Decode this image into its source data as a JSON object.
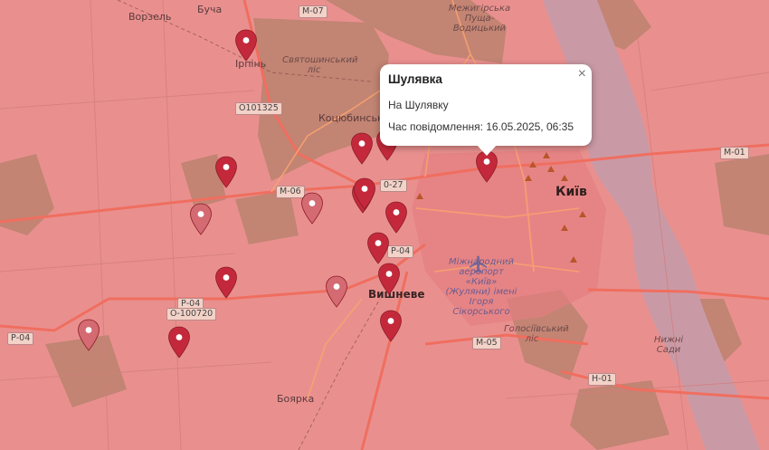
{
  "popup": {
    "title": "Шулявка",
    "description": "На Шулявку",
    "time_label": "Час повідомлення: 16.05.2025, 06:35",
    "close_symbol": "×"
  },
  "places": {
    "vorzel": "Ворзель",
    "bucha": "Буча",
    "irpin": "Ірпінь",
    "sviatoshynskyi_forest": "Святошинський ліс",
    "kotsiubynske": "Коцюбинське",
    "mezhyhirska": "Межигірська Пуща-Водицький",
    "kyiv": "Київ",
    "vyshneve": "Вишневе",
    "airport": "Міжнародний аеропорт «Київ» (Жуляни) імені Ігоря Сікорського",
    "holosiivskyi": "Голосіївський ліс",
    "nyzhni_sady": "Нижні Сади",
    "boiarka": "Боярка"
  },
  "roads": {
    "m07": "М-07",
    "m06": "М-06",
    "m01": "М-01",
    "m05": "М-05",
    "n01": "Н-01",
    "p04_a": "Р-04",
    "p04_b": "Р-04",
    "p04_c": "Р-04",
    "o100720": "О-100720",
    "o101325": "О101325",
    "r27": "0-27"
  },
  "colors": {
    "overlay": "#e9908f",
    "marker": "#c4293b",
    "marker_faded": "#d46a72",
    "water": "#c99aa6",
    "forest": "#b5806a"
  },
  "markers": [
    {
      "name": "marker-irpin",
      "faded": false
    },
    {
      "name": "marker-kotsiubynske",
      "faded": false
    },
    {
      "name": "marker-kotsiubynske-2",
      "faded": false
    },
    {
      "name": "marker-shuliavka",
      "faded": false
    },
    {
      "name": "marker-west-1",
      "faded": false
    },
    {
      "name": "marker-west-2",
      "faded": true
    },
    {
      "name": "marker-center-1",
      "faded": true
    },
    {
      "name": "marker-center-2",
      "faded": false
    },
    {
      "name": "marker-center-3",
      "faded": false
    },
    {
      "name": "marker-center-4",
      "faded": false
    },
    {
      "name": "marker-southwest",
      "faded": false
    },
    {
      "name": "marker-vyshneve-1",
      "faded": false
    },
    {
      "name": "marker-vyshneve-2",
      "faded": false
    },
    {
      "name": "marker-vyshneve-3",
      "faded": false
    },
    {
      "name": "marker-far-west-1",
      "faded": true
    },
    {
      "name": "marker-far-west-2",
      "faded": true
    },
    {
      "name": "marker-boiarka",
      "faded": false
    }
  ]
}
